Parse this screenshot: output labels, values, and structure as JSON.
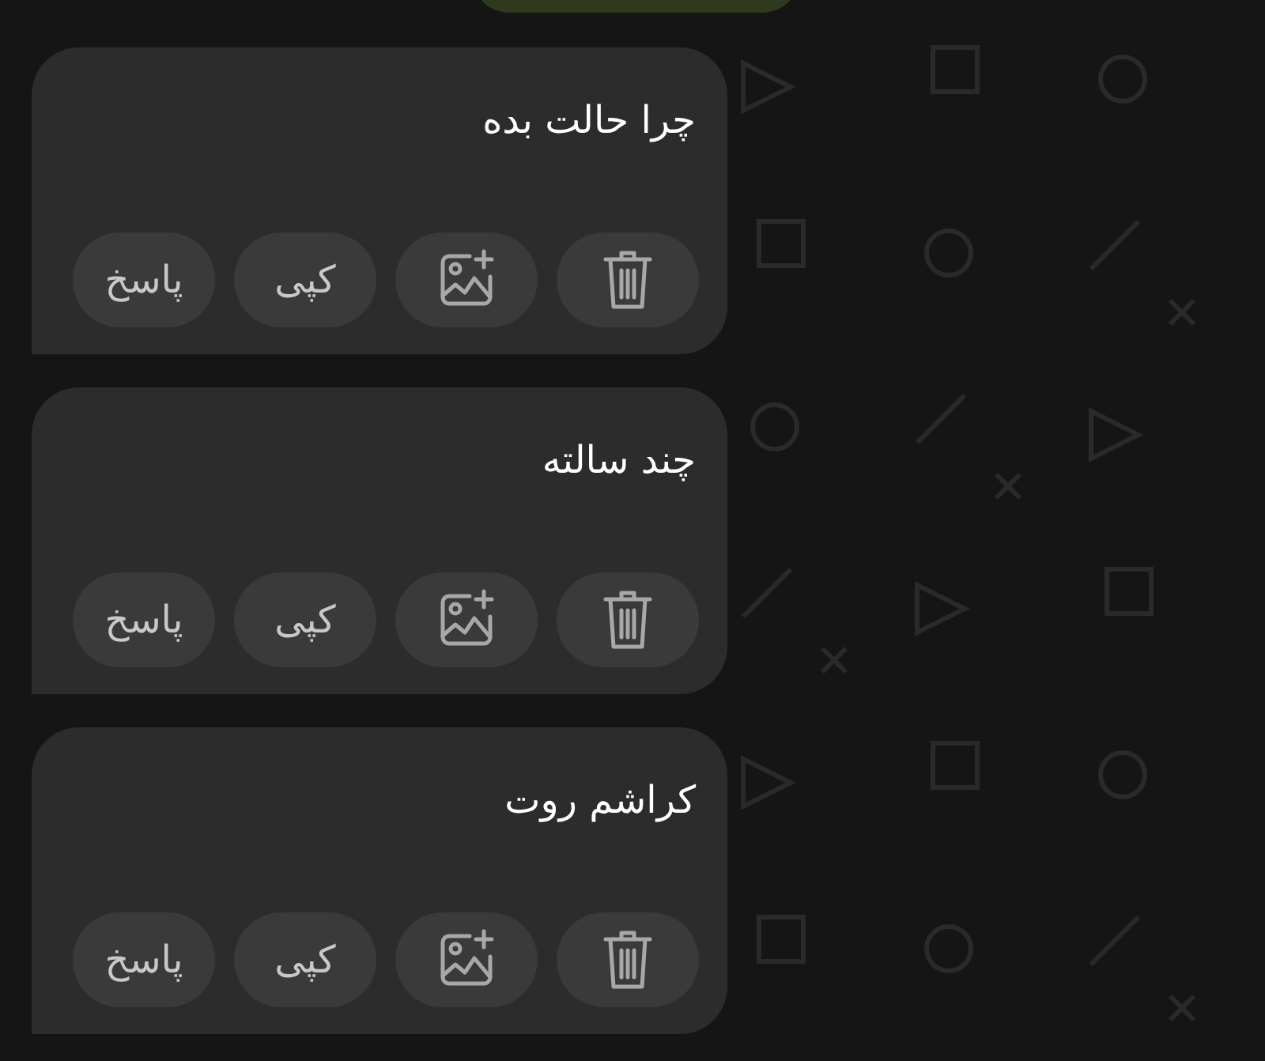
{
  "messages": [
    {
      "text": "چرا حالت بده",
      "actions": [
        {
          "kind": "delete"
        },
        {
          "kind": "add-image"
        },
        {
          "kind": "text",
          "label": "کپی"
        },
        {
          "kind": "text",
          "label": "پاسخ"
        }
      ]
    },
    {
      "text": "چند سالته",
      "actions": [
        {
          "kind": "delete"
        },
        {
          "kind": "add-image"
        },
        {
          "kind": "text",
          "label": "کپی"
        },
        {
          "kind": "text",
          "label": "پاسخ"
        }
      ]
    },
    {
      "text": "کراشم روت",
      "actions": [
        {
          "kind": "delete"
        },
        {
          "kind": "add-image"
        },
        {
          "kind": "text",
          "label": "کپی"
        },
        {
          "kind": "text",
          "label": "پاسخ"
        }
      ]
    }
  ]
}
